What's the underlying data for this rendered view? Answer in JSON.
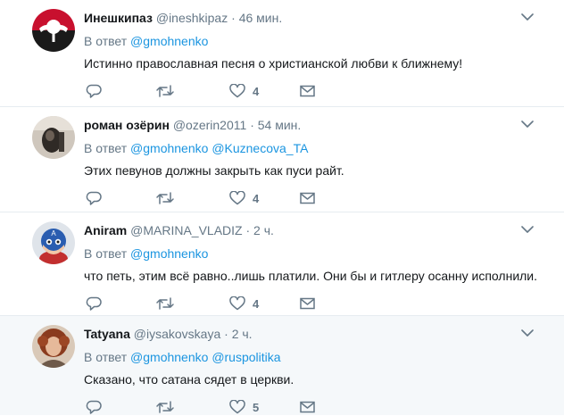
{
  "ui": {
    "reply_prefix": "В ответ",
    "dot": "·"
  },
  "tweets": [
    {
      "name": "Инешкипаз",
      "handle": "@ineshkipaz",
      "time": "46 мин.",
      "mentions": [
        "@gmohnenko"
      ],
      "text": "Истинно православная песня о христианской любви к ближнему!",
      "likes": "4",
      "avatar": "red-black-emblem",
      "highlighted": false
    },
    {
      "name": "роман озёрин",
      "handle": "@ozerin2011",
      "time": "54 мин.",
      "mentions": [
        "@gmohnenko",
        "@Kuznecova_TA"
      ],
      "text": "Этих певунов должны закрыть как пуси райт.",
      "likes": "4",
      "avatar": "dark-figure-photo",
      "highlighted": false
    },
    {
      "name": "Aniram",
      "handle": "@MARINA_VLADIZ",
      "time": "2 ч.",
      "mentions": [
        "@gmohnenko"
      ],
      "text": "что петь, этим всё равно..лишь платили. Они бы и гитлеру осанну исполнили.",
      "likes": "4",
      "avatar": "captain-america-toy",
      "highlighted": false
    },
    {
      "name": "Tatyana",
      "handle": "@iysakovskaya",
      "time": "2 ч.",
      "mentions": [
        "@gmohnenko",
        "@ruspolitika"
      ],
      "text": "Сказано, что сатана сядет в церкви.",
      "likes": "5",
      "avatar": "woman-portrait",
      "highlighted": true
    }
  ],
  "colors": {
    "link": "#1b95e0",
    "muted": "#657786",
    "text": "#14171a",
    "border": "#e6ecf0",
    "highlight_bg": "#f5f8fa"
  },
  "icons": {
    "reply": "reply-icon",
    "retweet": "retweet-icon",
    "like": "heart-icon",
    "dm": "envelope-icon",
    "caret": "chevron-down-icon"
  }
}
